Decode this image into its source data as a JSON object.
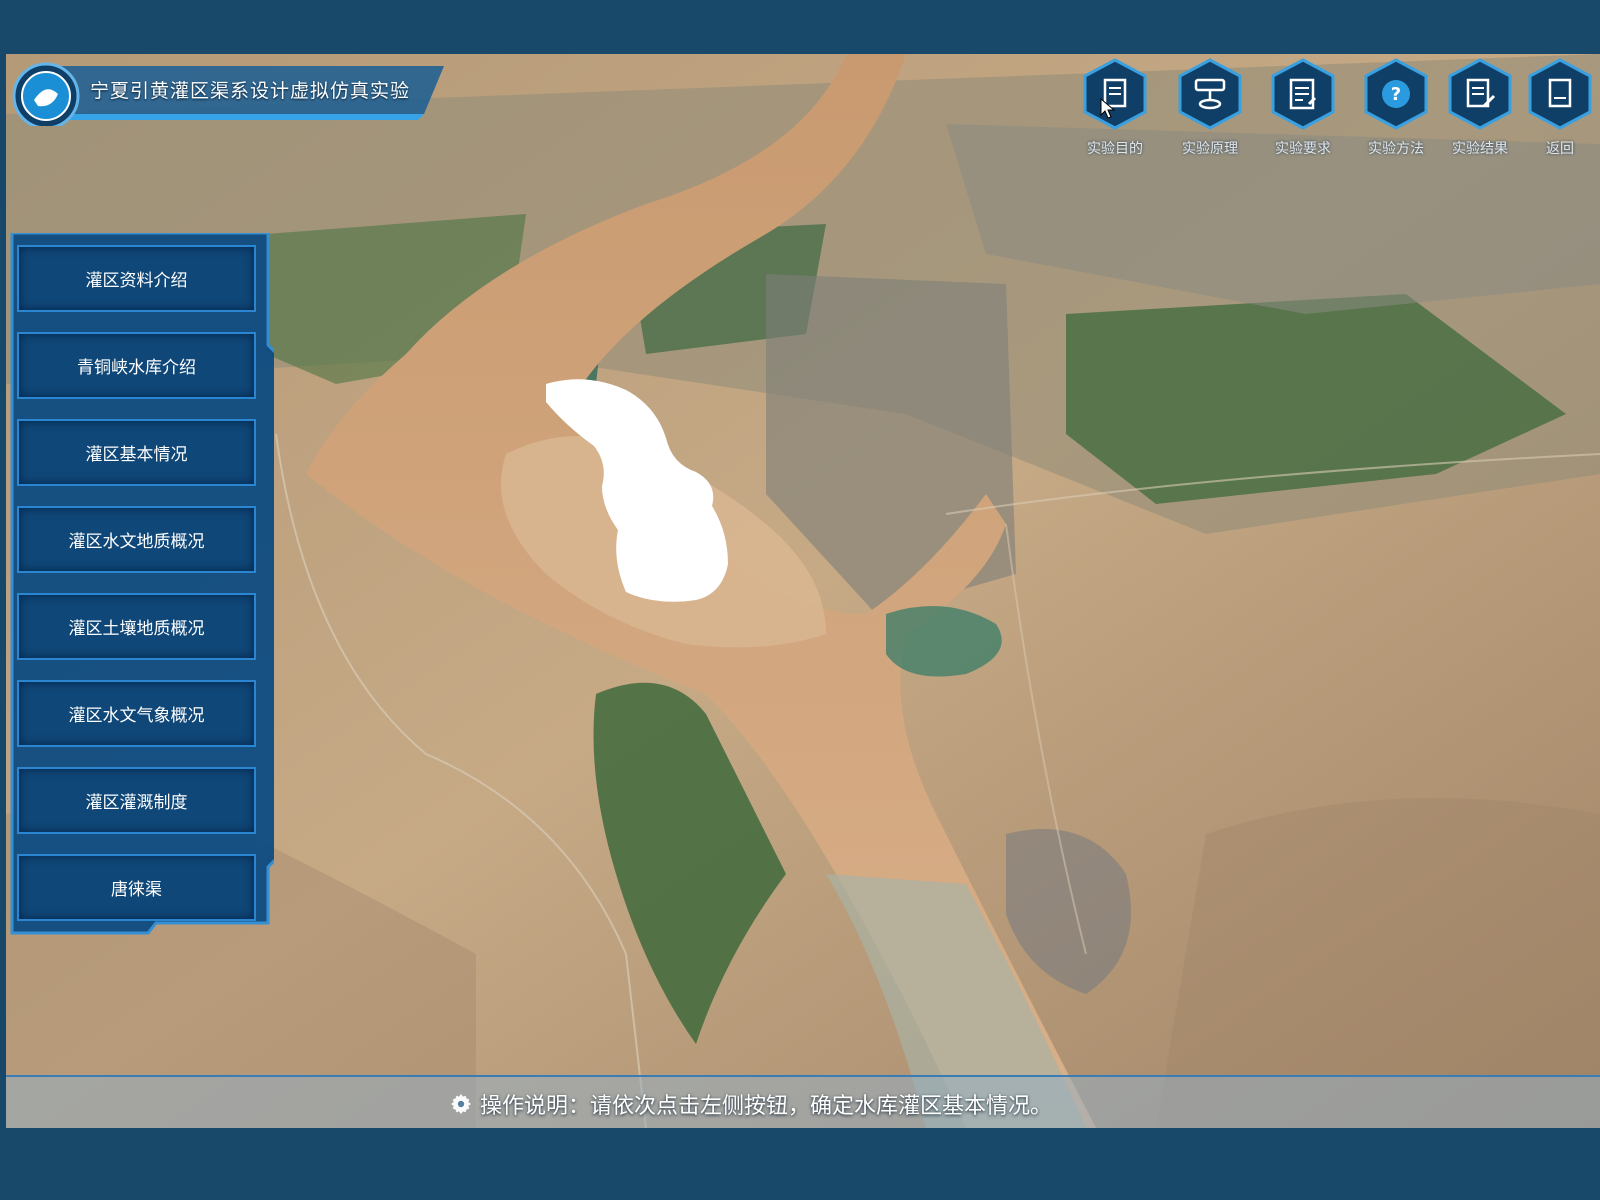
{
  "app": {
    "title": "宁夏引黄灌区渠系设计虚拟仿真实验"
  },
  "toolbar": [
    {
      "icon": "document-icon",
      "label": "实验目的"
    },
    {
      "icon": "diagram-icon",
      "label": "实验原理"
    },
    {
      "icon": "checklist-icon",
      "label": "实验要求"
    },
    {
      "icon": "help-icon",
      "label": "实验方法"
    },
    {
      "icon": "edit-icon",
      "label": "实验结果"
    },
    {
      "icon": "return-icon",
      "label": "返回"
    }
  ],
  "sidebar": {
    "items": [
      {
        "label": "灌区资料介绍"
      },
      {
        "label": "青铜峡水库介绍"
      },
      {
        "label": "灌区基本情况"
      },
      {
        "label": "灌区水文地质概况"
      },
      {
        "label": "灌区土壤地质概况"
      },
      {
        "label": "灌区水文气象概况"
      },
      {
        "label": "灌区灌溉制度"
      },
      {
        "label": "唐徕渠"
      }
    ]
  },
  "status": {
    "text": "操作说明：请依次点击左侧按钮，确定水库灌区基本情况。"
  },
  "colors": {
    "frame": "#18496b",
    "button_fill": "#0f4778",
    "button_border": "#2a86d0",
    "river": "#d2a57c",
    "farmland": "#3f6a3c"
  }
}
